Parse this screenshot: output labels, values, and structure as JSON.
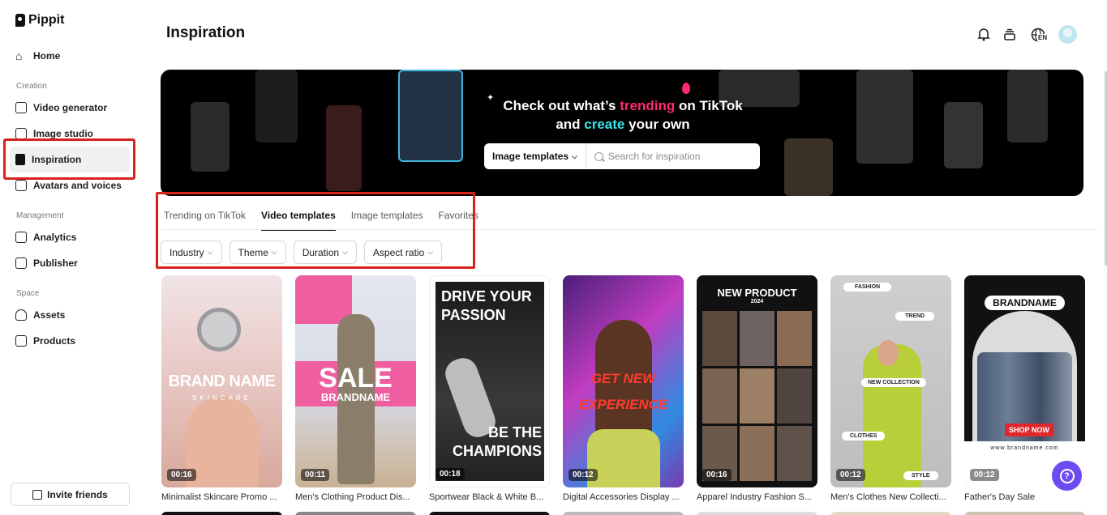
{
  "app": {
    "name": "Pippit"
  },
  "sidebar": {
    "home": "Home",
    "sections": {
      "creation": "Creation",
      "management": "Management",
      "space": "Space"
    },
    "creation_items": [
      "Video generator",
      "Image studio",
      "Inspiration",
      "Avatars and voices"
    ],
    "management_items": [
      "Analytics",
      "Publisher"
    ],
    "space_items": [
      "Assets",
      "Products"
    ],
    "active_item": "Inspiration",
    "invite": "Invite friends"
  },
  "header": {
    "title": "Inspiration",
    "icons": [
      "bell-icon",
      "stack-icon",
      "globe-en-icon",
      "user-avatar"
    ],
    "lang": "EN"
  },
  "banner": {
    "line1_pre": "Check out what’s ",
    "line1_accent": "trending",
    "line1_post": " on TikTok",
    "line2_pre": "and ",
    "line2_accent": "create",
    "line2_post": " your own",
    "select_label": "Image templates",
    "search_placeholder": "Search for inspiration",
    "accent_pink": "#ff2a6d",
    "accent_cyan": "#36e3e8"
  },
  "tabs": [
    "Trending on TikTok",
    "Video templates",
    "Image templates",
    "Favorites"
  ],
  "active_tab": "Video templates",
  "filters": [
    "Industry",
    "Theme",
    "Duration",
    "Aspect ratio"
  ],
  "cards": [
    {
      "title": "Minimalist Skincare Promo ...",
      "duration": "00:16",
      "overlay": "BRAND NAME",
      "overlay2": "SKINCARE"
    },
    {
      "title": "Men's Clothing Product Dis...",
      "duration": "00:11",
      "overlay": "SALE",
      "overlay2": "BRANDNAME"
    },
    {
      "title": "Sportwear Black & White B...",
      "duration": "00:18",
      "overlay": "DRIVE YOUR PASSION",
      "overlay2": "BE THE CHAMPIONS"
    },
    {
      "title": "Digital Accessories Display ...",
      "duration": "00:12",
      "overlay": "GET NEW",
      "overlay2": "EXPERIENCE"
    },
    {
      "title": "Apparel Industry Fashion S...",
      "duration": "00:16",
      "overlay": "NEW PRODUCT",
      "overlay2": "2024"
    },
    {
      "title": "Men's Clothes New Collecti...",
      "duration": "00:12",
      "overlay": "FASHION",
      "overlay2": "NEW COLLECTION",
      "tags": [
        "TREND",
        "CLOTHES",
        "STYLE"
      ]
    },
    {
      "title": "Father's Day Sale",
      "duration": "00:12",
      "overlay": "BRANDNAME",
      "overlay2": "SHOP NOW",
      "overlay3": "www.brandname.com"
    }
  ],
  "help": "?"
}
